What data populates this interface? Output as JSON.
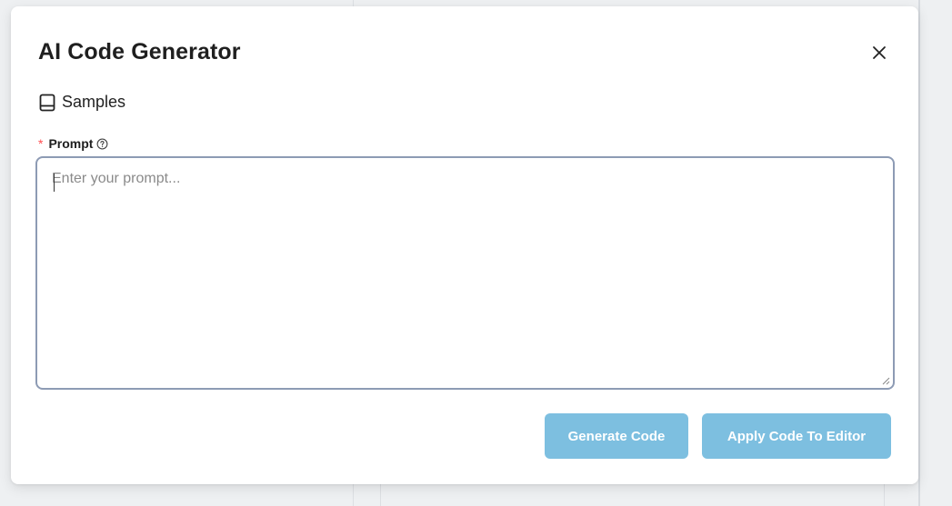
{
  "modal": {
    "title": "AI Code Generator",
    "close_icon": "close-icon"
  },
  "samples": {
    "label": "Samples",
    "icon": "book-icon"
  },
  "prompt": {
    "required_marker": "*",
    "label": "Prompt",
    "help_icon": "question-circle-icon",
    "placeholder": "Enter your prompt...",
    "value": ""
  },
  "actions": {
    "generate_label": "Generate Code",
    "apply_label": "Apply Code To Editor"
  },
  "colors": {
    "button_disabled_bg": "#7dbfe0",
    "required": "#ff4d4f",
    "textarea_border": "#8d9bb4"
  }
}
